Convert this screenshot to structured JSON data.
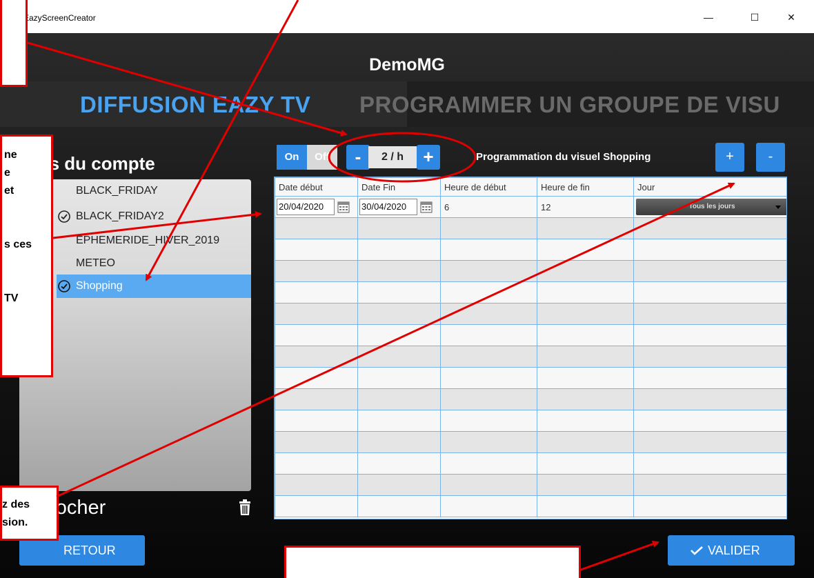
{
  "window": {
    "title": "EazyScreenCreator",
    "minimize": "—",
    "maximize": "☐",
    "close": "✕"
  },
  "app": {
    "title": "DemoMG"
  },
  "tabs": [
    {
      "label": "DIFFUSION EAZY TV",
      "color": "#4aa3f0"
    },
    {
      "label": "PROGRAMMER UN GROUPE DE VISU",
      "color": "#6a6a6a"
    }
  ],
  "sidebar": {
    "heading": "uels du compte",
    "items": [
      {
        "label": "BLACK_FRIDAY",
        "checked": false,
        "selected": false
      },
      {
        "label": "BLACK_FRIDAY2",
        "checked": true,
        "selected": false
      },
      {
        "label": "EPHEMERIDE_HIVER_2019",
        "checked": false,
        "selected": false
      },
      {
        "label": "METEO",
        "checked": false,
        "selected": false
      },
      {
        "label": "Shopping",
        "checked": true,
        "selected": true
      }
    ],
    "footer_text": "ut cocher"
  },
  "toolbar": {
    "toggle_on": "On",
    "toggle_off": "Off",
    "minus": "-",
    "frequency": "2 / h",
    "plus": "+",
    "program_title": "Programmation du visuel Shopping",
    "add_row": "+",
    "remove_row": "-"
  },
  "table": {
    "headers": [
      "Date début",
      "Date Fin",
      "Heure de début",
      "Heure de fin",
      "Jour"
    ],
    "row1": {
      "start_date": "20/04/2020",
      "end_date": "30/04/2020",
      "start_hour": "6",
      "end_hour": "12",
      "day": "Tous les jours"
    }
  },
  "buttons": {
    "back": "RETOUR",
    "validate": "VALIDER"
  },
  "annotations": {
    "left_box_1": "ne\ne\net\n\n\ns ces\n\n\nTV",
    "left_box_2": "z des\nsion."
  },
  "colors": {
    "accent": "#2e88e2",
    "selection": "#5aaaf2",
    "annotation": "#e00000"
  }
}
